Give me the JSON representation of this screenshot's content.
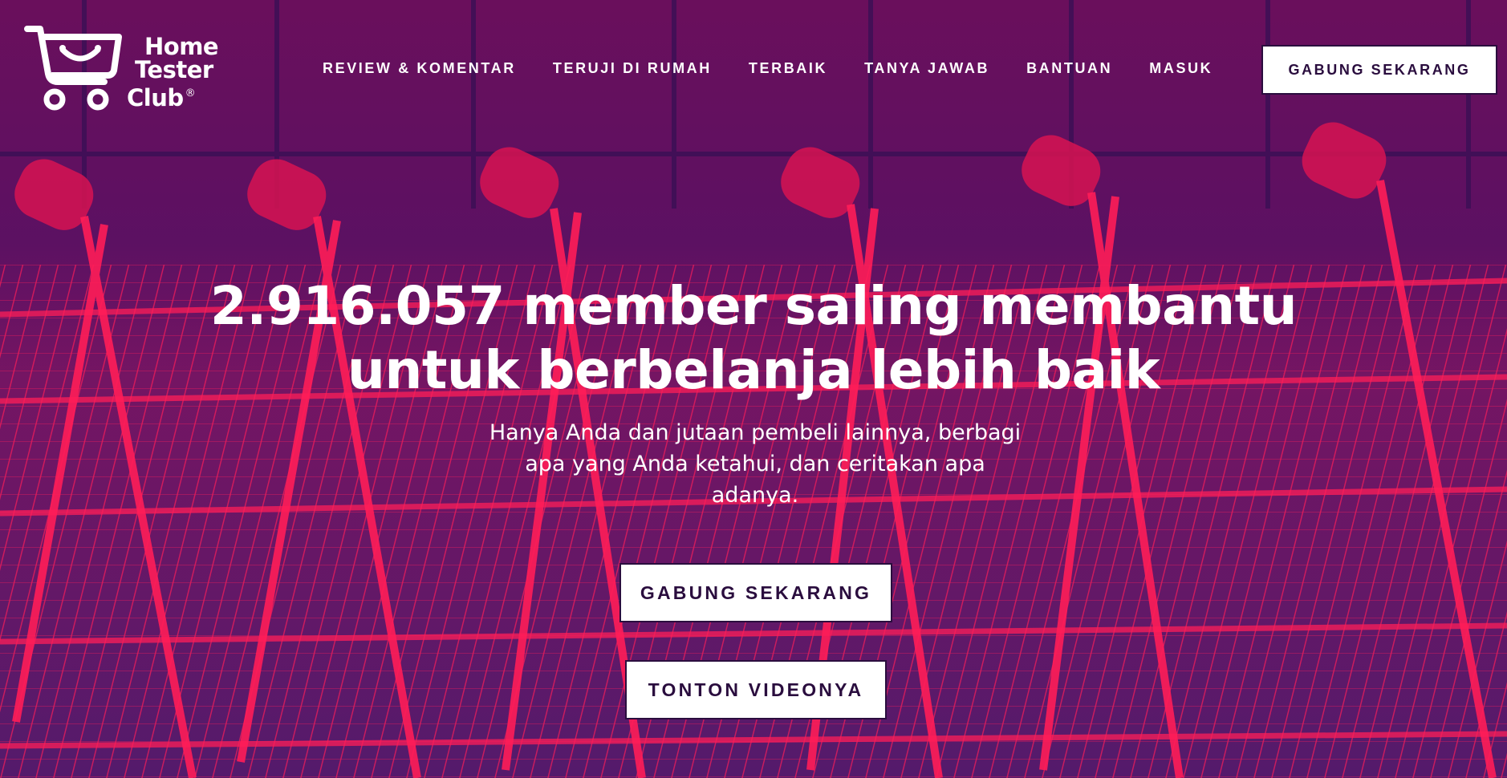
{
  "brand": {
    "name_line1": "Home",
    "name_line2": "Tester",
    "name_line3": "Club",
    "registered_mark": "®"
  },
  "nav": {
    "items": [
      {
        "label": "REVIEW & KOMENTAR"
      },
      {
        "label": "TERUJI DI RUMAH"
      },
      {
        "label": "TERBAIK"
      },
      {
        "label": "TANYA JAWAB"
      },
      {
        "label": "BANTUAN"
      },
      {
        "label": "MASUK"
      }
    ],
    "cta_label": "GABUNG SEKARANG"
  },
  "hero": {
    "headline_line1": "2.916.057 member saling membantu",
    "headline_line2": "untuk berbelanja lebih baik",
    "subtitle": "Hanya Anda dan jutaan pembeli lainnya, berbagi apa yang Anda ketahui, dan ceritakan apa adanya.",
    "join_button": "GABUNG SEKARANG",
    "video_button": "TONTON VIDEONYA"
  },
  "colors": {
    "background_purple": "#4a1466",
    "cart_red": "#ff1a55",
    "text_dark": "#2a0d3e",
    "text_light": "#ffffff"
  },
  "background_image": {
    "icon": "shopping-carts-photo"
  }
}
